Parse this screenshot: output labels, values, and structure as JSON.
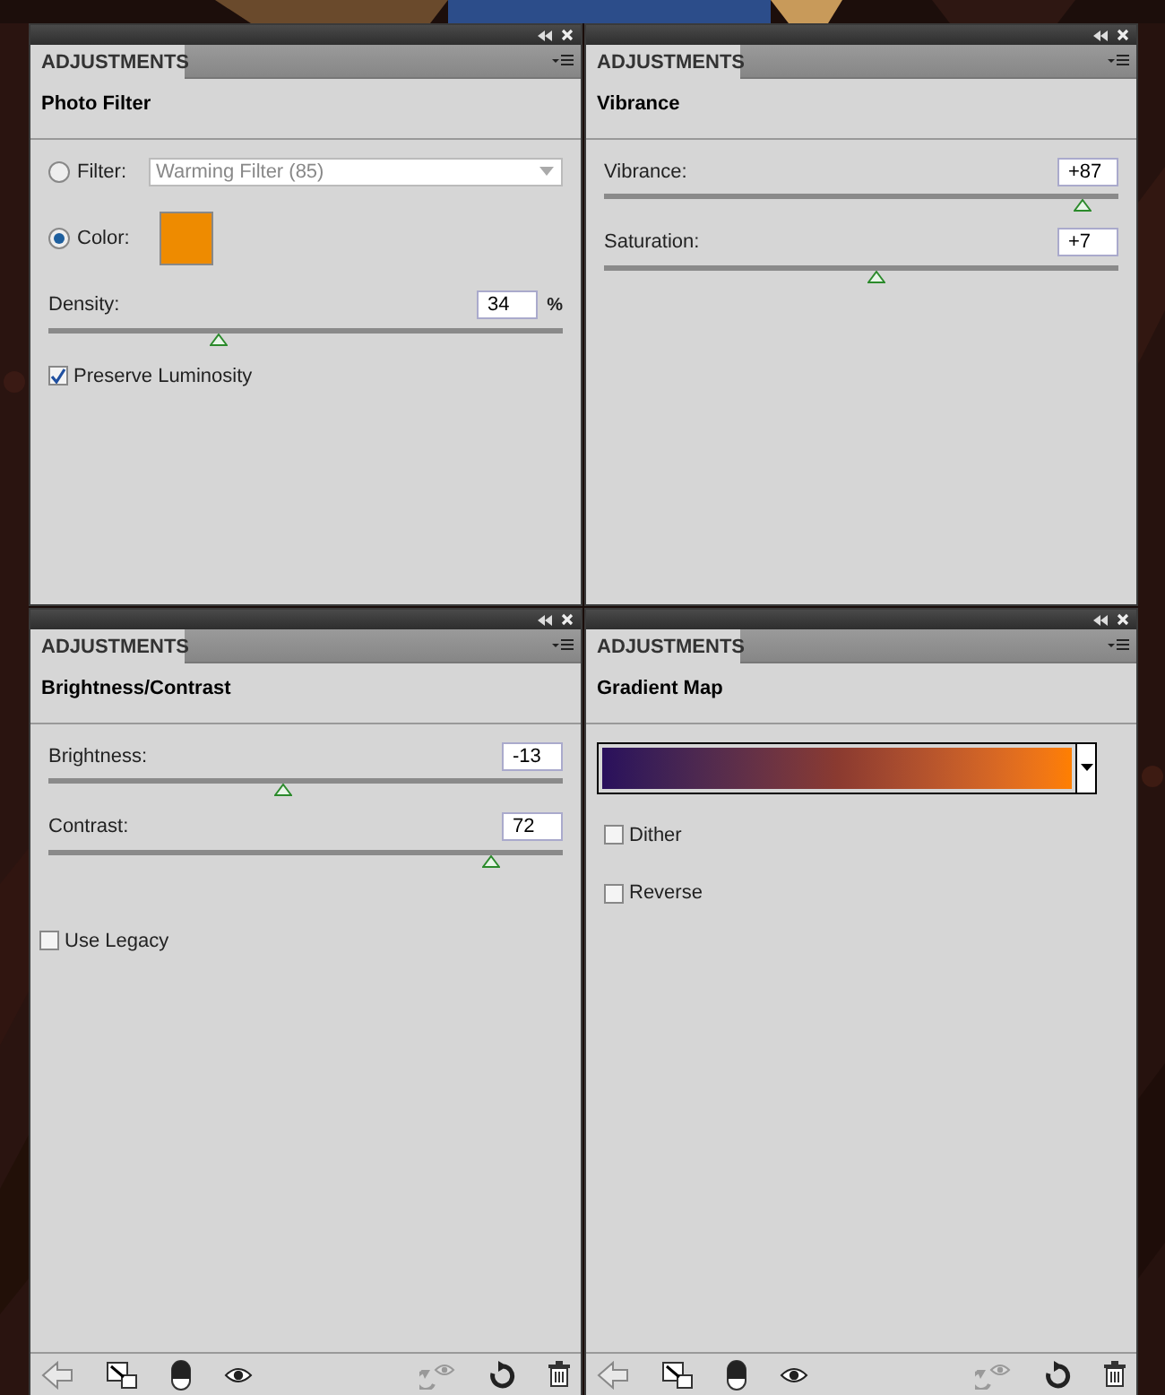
{
  "panels": [
    {
      "tab": "ADJUSTMENTS",
      "title": "Photo Filter",
      "footer": false,
      "controls": [
        {
          "kind": "radio",
          "label": "Filter:",
          "selected": false,
          "dropdown": "Warming Filter (85)"
        },
        {
          "kind": "radio",
          "label": "Color:",
          "selected": true,
          "color": "#ee8b00"
        },
        {
          "kind": "slider",
          "label": "Density:",
          "value": "34",
          "unit": "%",
          "level": 0.33
        },
        {
          "kind": "checkbox",
          "label": "Preserve Luminosity",
          "checked": true
        }
      ]
    },
    {
      "tab": "ADJUSTMENTS",
      "title": "Vibrance",
      "footer": false,
      "controls": [
        {
          "kind": "slider",
          "label": "Vibrance:",
          "value": "+87",
          "level": 0.93
        },
        {
          "kind": "slider",
          "label": "Saturation:",
          "value": "+7",
          "level": 0.53
        }
      ]
    },
    {
      "tab": "ADJUSTMENTS",
      "title": "Brightness/Contrast",
      "footer": true,
      "controls": [
        {
          "kind": "slider",
          "label": "Brightness:",
          "value": "-13",
          "level": 0.455
        },
        {
          "kind": "slider",
          "label": "Contrast:",
          "value": "72",
          "level": 0.86
        },
        {
          "kind": "checkbox",
          "label": "Use Legacy",
          "checked": false
        }
      ]
    },
    {
      "tab": "ADJUSTMENTS",
      "title": "Gradient Map",
      "footer": true,
      "controls": [
        {
          "kind": "gradient"
        },
        {
          "kind": "checkbox",
          "label": "Dither",
          "checked": false
        },
        {
          "kind": "checkbox",
          "label": "Reverse",
          "checked": false
        }
      ]
    }
  ]
}
